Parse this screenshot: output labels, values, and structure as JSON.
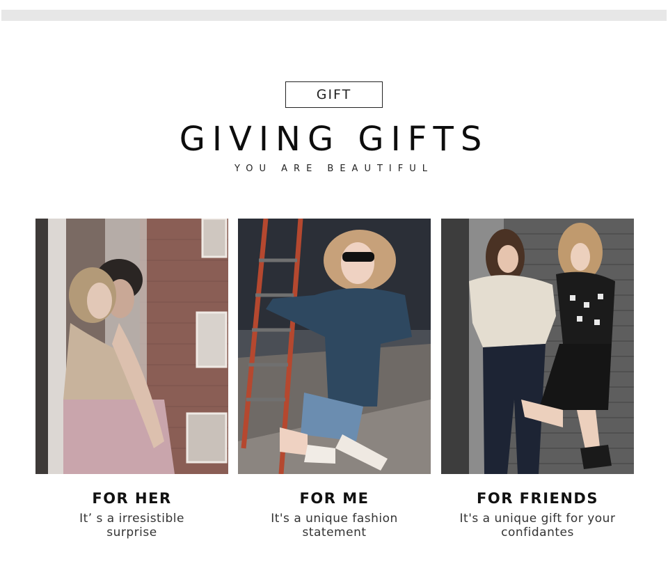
{
  "header": {
    "badge": "GIFT",
    "title": "GIVING GIFTS",
    "subtitle": "YOU ARE BEAUTIFUL"
  },
  "cards": [
    {
      "title": "FOR HER",
      "desc_line1": "It’ s a irresistible",
      "desc_line2": "surprise"
    },
    {
      "title": "FOR ME",
      "desc_line1": "It's a unique fashion",
      "desc_line2": "statement"
    },
    {
      "title": "FOR FRIENDS",
      "desc_line1": "It's a unique gift for your",
      "desc_line2": "confidantes"
    }
  ],
  "colors": {
    "top_bar": "#e7e7e7",
    "text": "#111111"
  }
}
